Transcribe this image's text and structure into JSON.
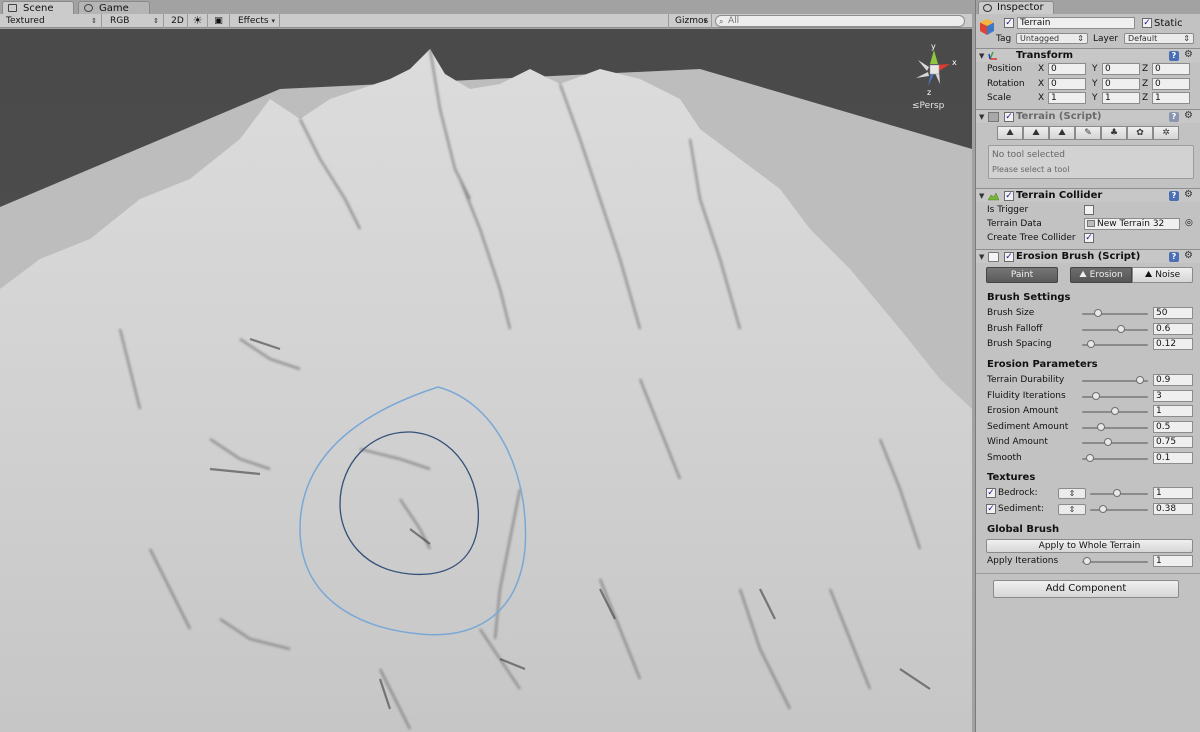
{
  "scene": {
    "tabs": [
      {
        "label": "Scene",
        "icon": "scene-icon"
      },
      {
        "label": "Game",
        "icon": "game-icon"
      }
    ],
    "toolbar": {
      "shading_mode": "Textured",
      "render_mode": "RGB",
      "mode_2d": "2D",
      "effects": "Effects",
      "gizmos": "Gizmos",
      "search_placeholder": "All"
    },
    "persp_label": "Persp",
    "axis_labels": {
      "x": "x",
      "y": "y",
      "z": "z"
    }
  },
  "inspector": {
    "tab_label": "Inspector",
    "object": {
      "active": true,
      "name": "Terrain",
      "static_label": "Static",
      "static_checked": true,
      "tag_label": "Tag",
      "tag_value": "Untagged",
      "layer_label": "Layer",
      "layer_value": "Default"
    },
    "transform": {
      "title": "Transform",
      "rows": [
        {
          "label": "Position",
          "x": "0",
          "y": "0",
          "z": "0"
        },
        {
          "label": "Rotation",
          "x": "0",
          "y": "0",
          "z": "0"
        },
        {
          "label": "Scale",
          "x": "1",
          "y": "1",
          "z": "1"
        }
      ],
      "axis_x": "X",
      "axis_y": "Y",
      "axis_z": "Z"
    },
    "terrain_script": {
      "title": "Terrain (Script)",
      "help_title": "No tool selected",
      "help_body": "Please select a tool"
    },
    "terrain_collider": {
      "title": "Terrain Collider",
      "is_trigger_label": "Is Trigger",
      "is_trigger": false,
      "terrain_data_label": "Terrain Data",
      "terrain_data_value": "New Terrain 32",
      "tree_collider_label": "Create Tree Collider",
      "tree_collider": true
    },
    "erosion_brush": {
      "title": "Erosion Brush (Script)",
      "paint_label": "Paint",
      "erosion_label": "Erosion",
      "noise_label": "Noise",
      "brush_settings_title": "Brush Settings",
      "brush_settings": [
        {
          "label": "Brush Size",
          "value": "50",
          "fraction": 0.22
        },
        {
          "label": "Brush Falloff",
          "value": "0.6",
          "fraction": 0.6
        },
        {
          "label": "Brush Spacing",
          "value": "0.12",
          "fraction": 0.12
        }
      ],
      "erosion_params_title": "Erosion Parameters",
      "erosion_params": [
        {
          "label": "Terrain Durability",
          "value": "0.9",
          "fraction": 0.9
        },
        {
          "label": "Fluidity Iterations",
          "value": "3",
          "fraction": 0.2
        },
        {
          "label": "Erosion Amount",
          "value": "1",
          "fraction": 0.5
        },
        {
          "label": "Sediment Amount",
          "value": "0.5",
          "fraction": 0.27
        },
        {
          "label": "Wind Amount",
          "value": "0.75",
          "fraction": 0.38
        },
        {
          "label": "Smooth",
          "value": "0.1",
          "fraction": 0.1
        }
      ],
      "textures_title": "Textures",
      "textures": [
        {
          "label": "Bedrock:",
          "checked": true,
          "value": "1",
          "fraction": 0.47
        },
        {
          "label": "Sediment:",
          "checked": true,
          "value": "0.38",
          "fraction": 0.2
        }
      ],
      "global_brush_title": "Global Brush",
      "apply_whole_label": "Apply to Whole Terrain",
      "apply_iterations_label": "Apply Iterations",
      "apply_iterations_value": "1",
      "apply_iterations_fraction": 0.05
    },
    "add_component_label": "Add Component"
  }
}
